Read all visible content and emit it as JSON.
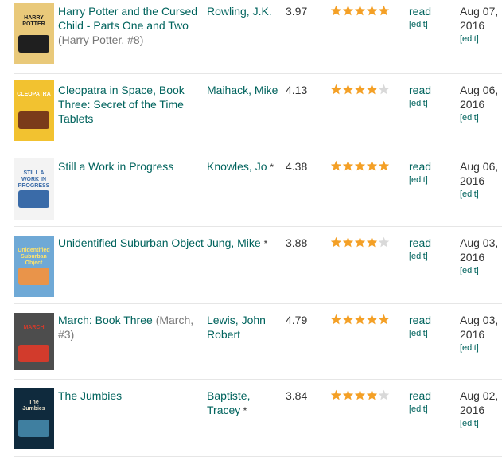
{
  "colors": {
    "link": "#00635d",
    "star_on": "#f4a026",
    "star_off": "#d9d9d9",
    "divider": "#e6e6e6"
  },
  "books": [
    {
      "title": "Harry Potter and the Cursed Child - Parts One and Two",
      "series": "(Harry Potter, #8)",
      "author_line1": "Rowling, J.K.",
      "author_line2": "",
      "author_mark": "",
      "avg_rating": "3.97",
      "stars": 5,
      "shelf": "read",
      "shelf_edit": "[edit]",
      "date_line1": "Aug 07,",
      "date_line2": "2016",
      "date_edit": "[edit]",
      "cover": {
        "bg": "#e9c97a",
        "accent": "#1f1f1f",
        "text": "HARRY POTTER",
        "text_color": "#1f1f1f"
      }
    },
    {
      "title": "Cleopatra in Space, Book Three: Secret of the Time Tablets",
      "series": "",
      "author_line1": "Maihack, Mike",
      "author_line2": "",
      "author_mark": "",
      "avg_rating": "4.13",
      "stars": 4,
      "shelf": "read",
      "shelf_edit": "[edit]",
      "date_line1": "Aug 06,",
      "date_line2": "2016",
      "date_edit": "[edit]",
      "cover": {
        "bg": "#f2c230",
        "accent": "#7a3b1a",
        "text": "CLEOPATRA",
        "text_color": "#ffffff"
      }
    },
    {
      "title": "Still a Work in Progress",
      "series": "",
      "author_line1": "Knowles, Jo",
      "author_line2": "",
      "author_mark": "*",
      "avg_rating": "4.38",
      "stars": 5,
      "shelf": "read",
      "shelf_edit": "[edit]",
      "date_line1": "Aug 06,",
      "date_line2": "2016",
      "date_edit": "[edit]",
      "cover": {
        "bg": "#f3f3f3",
        "accent": "#3a6ba8",
        "text": "STILL A WORK IN PROGRESS",
        "text_color": "#3a6ba8"
      }
    },
    {
      "title": "Unidentified Suburban Object",
      "series": "",
      "author_line1": "Jung, Mike",
      "author_line2": "",
      "author_mark": "*",
      "avg_rating": "3.88",
      "stars": 4,
      "shelf": "read",
      "shelf_edit": "[edit]",
      "date_line1": "Aug 03,",
      "date_line2": "2016",
      "date_edit": "[edit]",
      "cover": {
        "bg": "#6fa9d6",
        "accent": "#e9944a",
        "text": "Unidentified Suburban Object",
        "text_color": "#ffe36a"
      }
    },
    {
      "title": "March: Book Three",
      "series": "(March, #3)",
      "author_line1": "Lewis, John",
      "author_line2": "Robert",
      "author_mark": "",
      "avg_rating": "4.79",
      "stars": 5,
      "shelf": "read",
      "shelf_edit": "[edit]",
      "date_line1": "Aug 03,",
      "date_line2": "2016",
      "date_edit": "[edit]",
      "cover": {
        "bg": "#4d4d4d",
        "accent": "#d23b2c",
        "text": "MARCH",
        "text_color": "#d23b2c"
      }
    },
    {
      "title": "The Jumbies",
      "series": "",
      "author_line1": "Baptiste,",
      "author_line2": "Tracey",
      "author_mark": "*",
      "avg_rating": "3.84",
      "stars": 4,
      "shelf": "read",
      "shelf_edit": "[edit]",
      "date_line1": "Aug 02,",
      "date_line2": "2016",
      "date_edit": "[edit]",
      "cover": {
        "bg": "#0f2a3d",
        "accent": "#3f7fa0",
        "text": "The Jumbies",
        "text_color": "#e8e0c8"
      }
    }
  ]
}
